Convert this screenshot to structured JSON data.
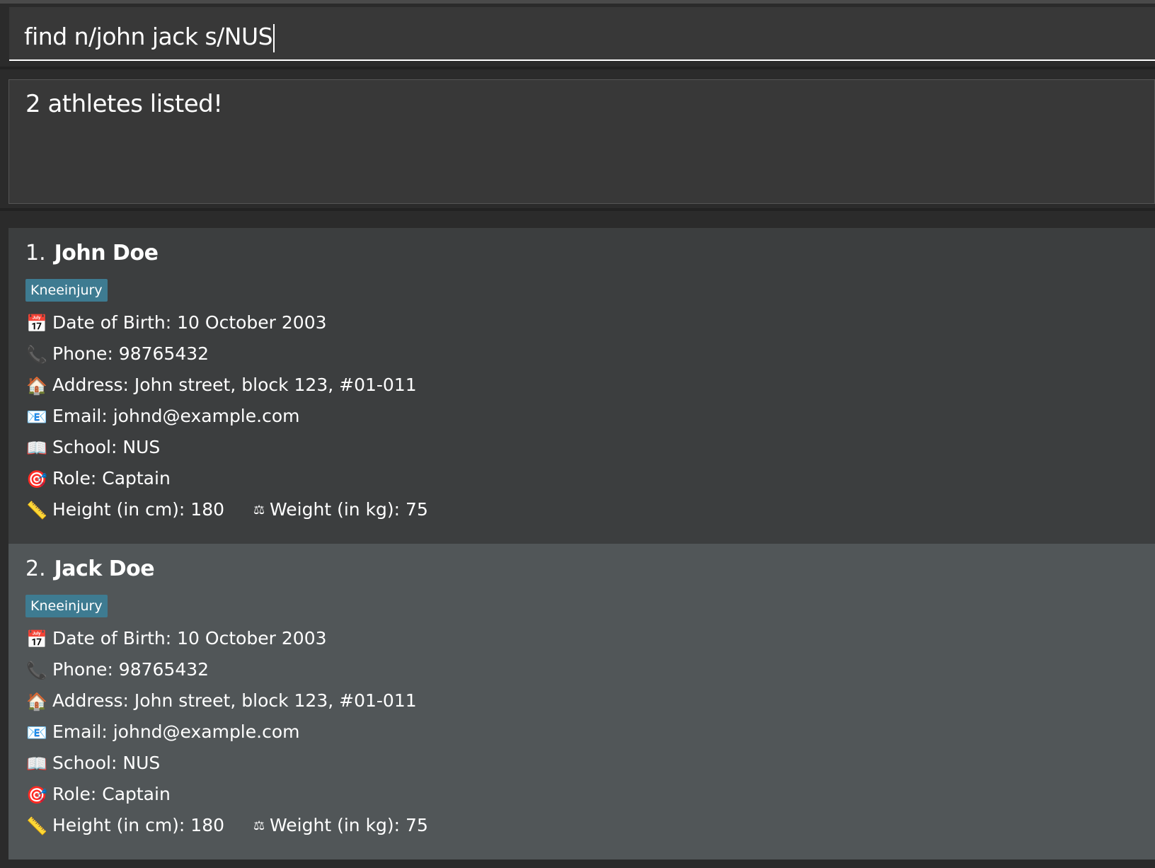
{
  "command": {
    "value": "find n/john jack s/NUS"
  },
  "result": {
    "message": "2 athletes listed!"
  },
  "athletes": [
    {
      "index": "1.",
      "name": "John Doe",
      "tag": "Kneeinjury",
      "dob": "Date of Birth: 10 October 2003",
      "phone": "Phone: 98765432",
      "address": "Address: John street, block 123, #01-011",
      "email": "Email: johnd@example.com",
      "school": "School: NUS",
      "role": "Role: Captain",
      "height": "Height (in cm): 180",
      "weight": "Weight (in kg): 75"
    },
    {
      "index": "2.",
      "name": "Jack Doe",
      "tag": "Kneeinjury",
      "dob": "Date of Birth: 10 October 2003",
      "phone": "Phone: 98765432",
      "address": "Address: John street, block 123, #01-011",
      "email": "Email: johnd@example.com",
      "school": "School: NUS",
      "role": "Role: Captain",
      "height": "Height (in cm): 180",
      "weight": "Weight (in kg): 75"
    }
  ],
  "icons": {
    "dob": "calendar-icon",
    "phone": "phone-icon",
    "address": "house-icon",
    "email": "email-icon",
    "school": "book-icon",
    "role": "target-icon",
    "height": "ruler-icon",
    "weight": "scale-icon"
  },
  "colors": {
    "background": "#2b2b2b",
    "panel": "#383838",
    "card_odd": "#3c3e3f",
    "card_even": "#515658",
    "tag": "#3e7b91"
  }
}
